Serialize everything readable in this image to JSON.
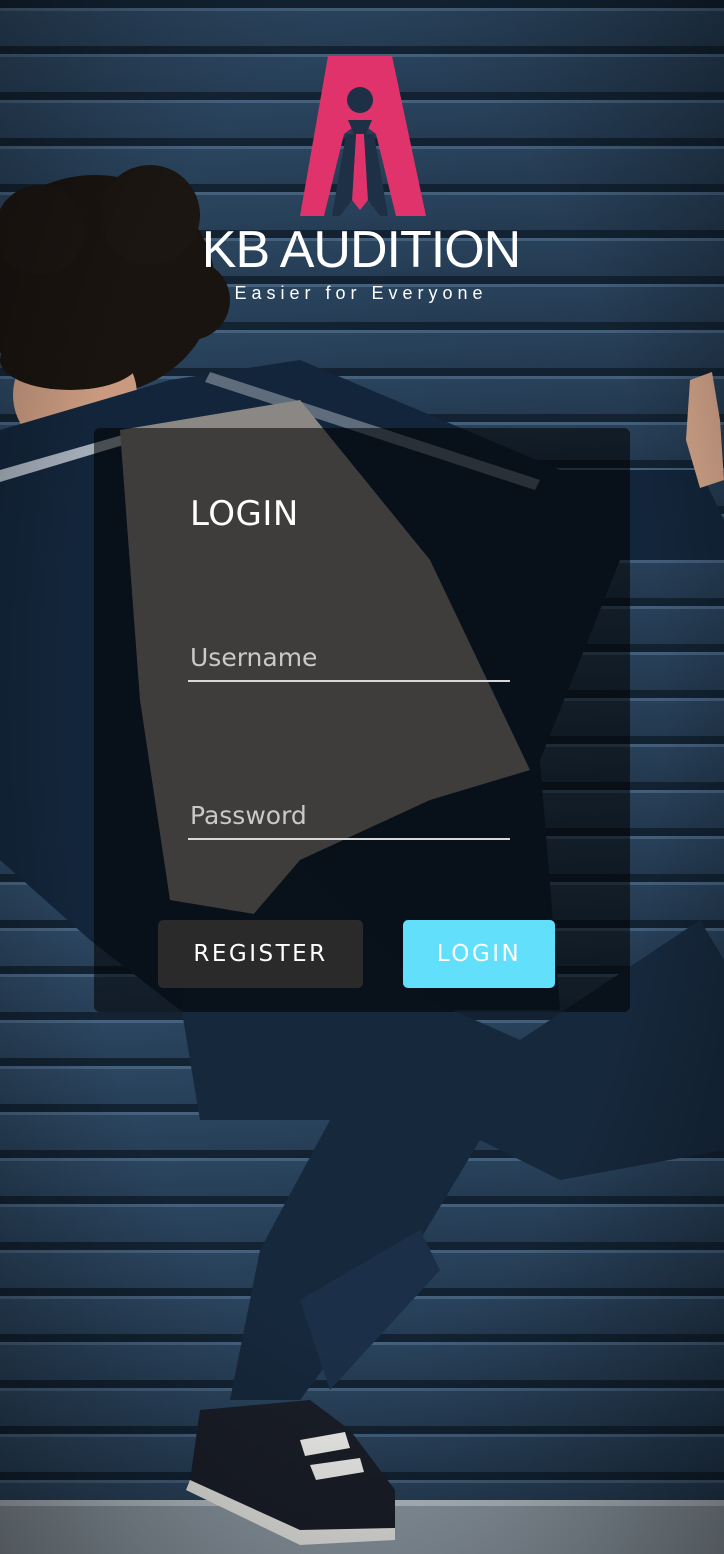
{
  "brand": {
    "name": "KB AUDITION",
    "tagline": "Easier for Everyone",
    "logo_color": "#e0336b"
  },
  "login_form": {
    "title": "LOGIN",
    "username_placeholder": "Username",
    "username_value": "",
    "password_placeholder": "Password",
    "password_value": "",
    "register_label": "REGISTER",
    "login_label": "LOGIN",
    "login_button_color": "#62e0fb"
  }
}
